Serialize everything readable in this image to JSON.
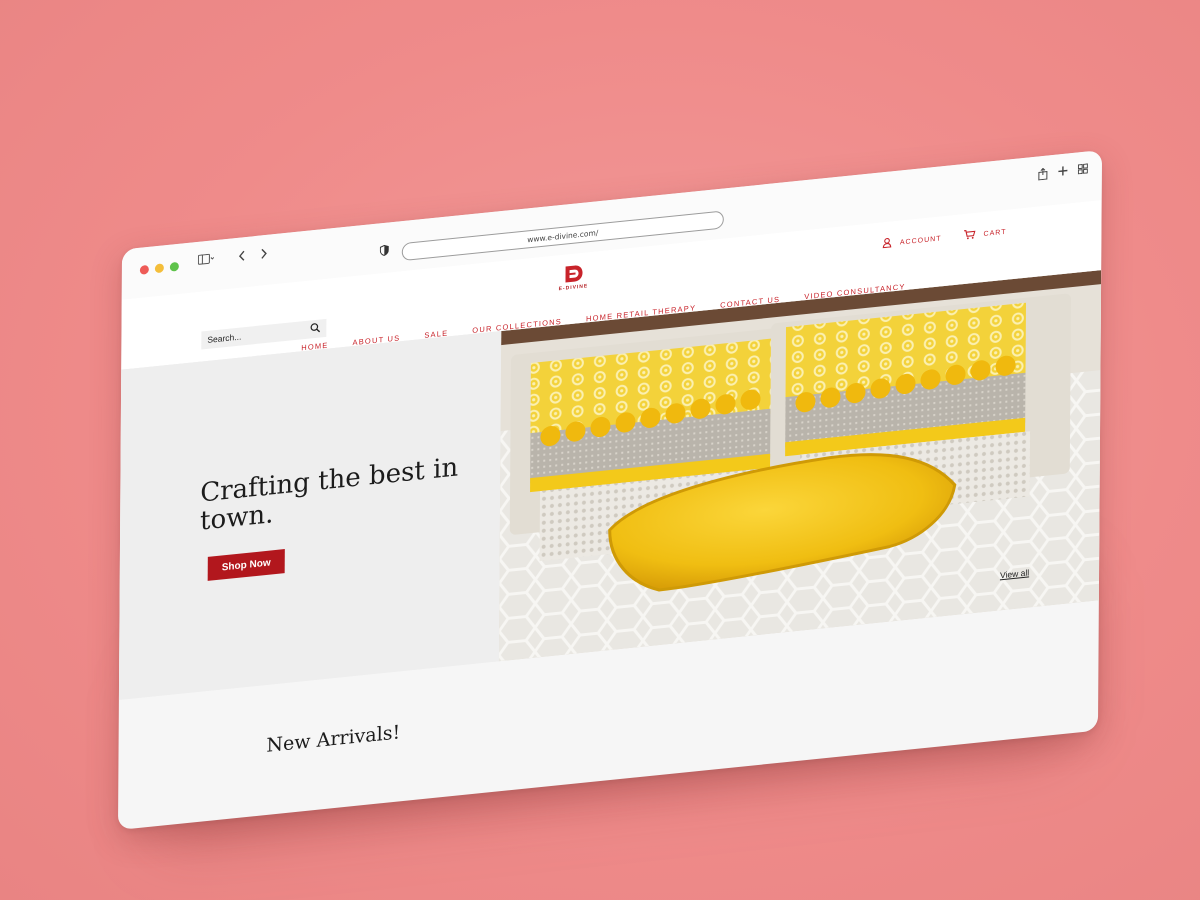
{
  "browser": {
    "url": "www.e-divine.com/"
  },
  "header": {
    "search_placeholder": "Search...",
    "logo_text": "E-DIVINE",
    "account_label": "ACCOUNT",
    "cart_label": "CART"
  },
  "nav": {
    "items": [
      {
        "label": "HOME"
      },
      {
        "label": "ABOUT US"
      },
      {
        "label": "SALE"
      },
      {
        "label": "OUR COLLECTIONS"
      },
      {
        "label": "HOME RETAIL THERAPY"
      },
      {
        "label": "CONTACT US"
      },
      {
        "label": "VIDEO CONSULTANCY"
      }
    ]
  },
  "hero": {
    "headline": "Crafting the best in town.",
    "cta_label": "Shop Now"
  },
  "sections": {
    "view_all_label": "View all",
    "new_arrivals_title": "New Arrivals!"
  },
  "colors": {
    "background": "#ef8b8a",
    "brand_red": "#b2171d",
    "accent_yellow": "#f2c417"
  }
}
